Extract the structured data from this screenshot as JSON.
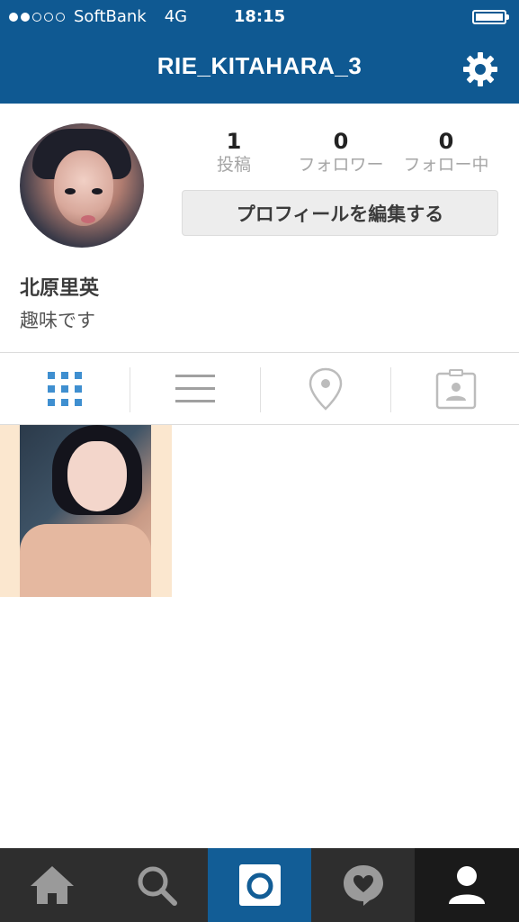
{
  "status_bar": {
    "carrier": "SoftBank",
    "network": "4G",
    "time": "18:15",
    "signal_bars_filled": 2,
    "signal_bars_total": 5
  },
  "nav": {
    "title": "RIE_KITAHARA_3"
  },
  "profile": {
    "stats": [
      {
        "value": "1",
        "label": "投稿"
      },
      {
        "value": "0",
        "label": "フォロワー"
      },
      {
        "value": "0",
        "label": "フォロー中"
      }
    ],
    "edit_button_label": "プロフィールを編集する",
    "name": "北原里英",
    "bio": "趣味です"
  },
  "view_tabs": [
    {
      "icon": "grid-icon",
      "active": true
    },
    {
      "icon": "list-icon",
      "active": false
    },
    {
      "icon": "location-pin-icon",
      "active": false
    },
    {
      "icon": "tagged-person-icon",
      "active": false
    }
  ],
  "bottom_nav": [
    {
      "icon": "home-icon"
    },
    {
      "icon": "search-icon"
    },
    {
      "icon": "camera-icon"
    },
    {
      "icon": "activity-heart-icon"
    },
    {
      "icon": "profile-icon"
    }
  ],
  "colors": {
    "header_bg": "#0f5992",
    "active_tab": "#3f8fd0",
    "bottom_bar_bg": "#2e2e2e",
    "camera_bg": "#125d96"
  }
}
